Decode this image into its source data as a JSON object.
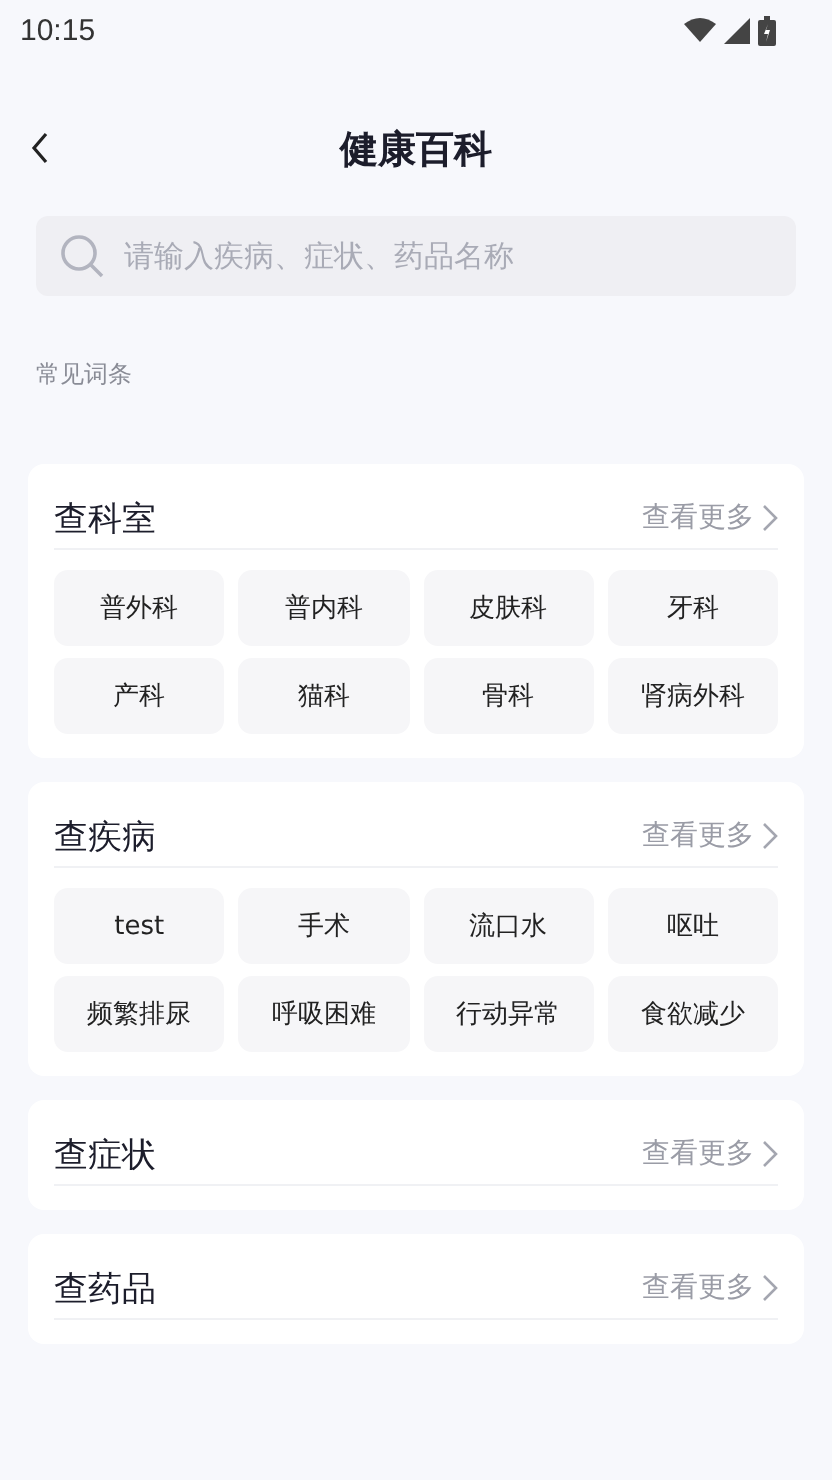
{
  "status_bar": {
    "time": "10:15"
  },
  "header": {
    "title": "健康百科"
  },
  "search": {
    "placeholder": "请输入疾病、症状、药品名称"
  },
  "common_terms": {
    "label": "常见词条"
  },
  "sections": [
    {
      "title": "查科室",
      "more": "查看更多",
      "tags": [
        "普外科",
        "普内科",
        "皮肤科",
        "牙科",
        "产科",
        "猫科",
        "骨科",
        "肾病外科"
      ]
    },
    {
      "title": "查疾病",
      "more": "查看更多",
      "tags": [
        "test",
        "手术",
        "流口水",
        "呕吐",
        "频繁排尿",
        "呼吸困难",
        "行动异常",
        "食欲减少"
      ]
    },
    {
      "title": "查症状",
      "more": "查看更多"
    },
    {
      "title": "查药品",
      "more": "查看更多"
    }
  ]
}
